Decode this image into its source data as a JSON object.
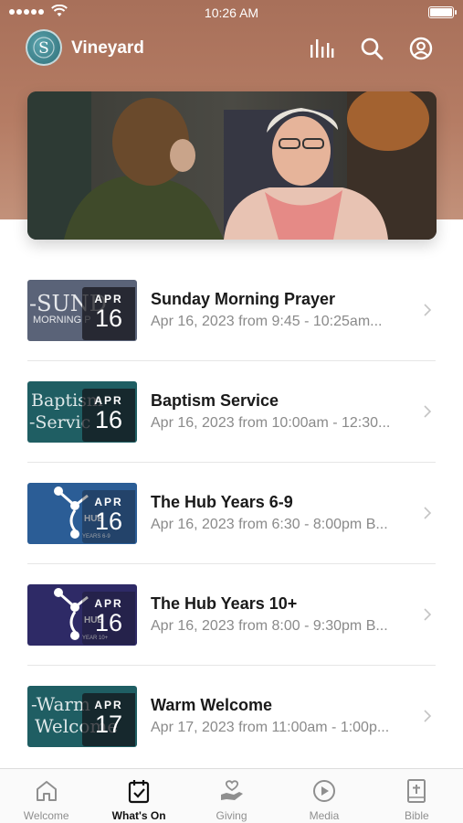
{
  "status_bar": {
    "time": "10:26 AM"
  },
  "header": {
    "app_name": "Vineyard",
    "logo_letter": "S",
    "icons": [
      "bars-icon",
      "search-icon",
      "profile-icon"
    ]
  },
  "events": [
    {
      "title": "Sunday Morning Prayer",
      "subtitle": "Apr 16, 2023 from 9:45 - 10:25am...",
      "month": "APR",
      "day": "16",
      "thumb_text": "-SUND",
      "thumb_sub": "MORNING P",
      "thumb_color": "#5a6378"
    },
    {
      "title": "Baptism Service",
      "subtitle": "Apr 16, 2023 from 10:00am - 12:30...",
      "month": "APR",
      "day": "16",
      "thumb_text": "Baptism",
      "thumb_sub": "-Servic",
      "thumb_color": "#1f5e63"
    },
    {
      "title": "The Hub Years 6-9",
      "subtitle": "Apr 16, 2023 from 6:30 - 8:00pm B...",
      "month": "APR",
      "day": "16",
      "thumb_text": "HUB",
      "thumb_sub": "YEARS 6-9",
      "thumb_color": "#2b5d96"
    },
    {
      "title": "The Hub Years 10+",
      "subtitle": "Apr 16, 2023 from 8:00 - 9:30pm B...",
      "month": "APR",
      "day": "16",
      "thumb_text": "HUB",
      "thumb_sub": "YEAR 10+",
      "thumb_color": "#2e2a66"
    },
    {
      "title": "Warm Welcome",
      "subtitle": "Apr 17, 2023 from 11:00am - 1:00p...",
      "month": "APR",
      "day": "17",
      "thumb_text": "-Warm",
      "thumb_sub": "Welcome",
      "thumb_color": "#1f5e63"
    }
  ],
  "tabs": [
    {
      "label": "Welcome",
      "icon": "home-icon",
      "active": false
    },
    {
      "label": "What's On",
      "icon": "calendar-check-icon",
      "active": true
    },
    {
      "label": "Giving",
      "icon": "giving-hand-icon",
      "active": false
    },
    {
      "label": "Media",
      "icon": "play-circle-icon",
      "active": false
    },
    {
      "label": "Bible",
      "icon": "bible-icon",
      "active": false
    }
  ]
}
